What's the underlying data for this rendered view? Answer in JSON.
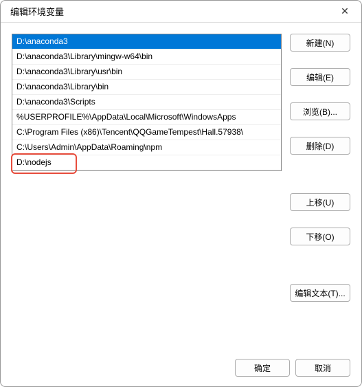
{
  "titlebar": {
    "title": "编辑环境变量",
    "close_icon": "✕"
  },
  "list": {
    "items": [
      {
        "value": "D:\\anaconda3",
        "selected": true
      },
      {
        "value": "D:\\anaconda3\\Library\\mingw-w64\\bin",
        "selected": false
      },
      {
        "value": "D:\\anaconda3\\Library\\usr\\bin",
        "selected": false
      },
      {
        "value": "D:\\anaconda3\\Library\\bin",
        "selected": false
      },
      {
        "value": "D:\\anaconda3\\Scripts",
        "selected": false
      },
      {
        "value": "%USERPROFILE%\\AppData\\Local\\Microsoft\\WindowsApps",
        "selected": false
      },
      {
        "value": "C:\\Program Files (x86)\\Tencent\\QQGameTempest\\Hall.57938\\",
        "selected": false
      },
      {
        "value": "C:\\Users\\Admin\\AppData\\Roaming\\npm",
        "selected": false
      },
      {
        "value": "D:\\nodejs",
        "selected": false,
        "highlighted": true
      }
    ]
  },
  "buttons": {
    "new": "新建(N)",
    "edit": "编辑(E)",
    "browse": "浏览(B)...",
    "delete": "删除(D)",
    "move_up": "上移(U)",
    "move_down": "下移(O)",
    "edit_text": "编辑文本(T)..."
  },
  "footer": {
    "ok": "确定",
    "cancel": "取消"
  }
}
